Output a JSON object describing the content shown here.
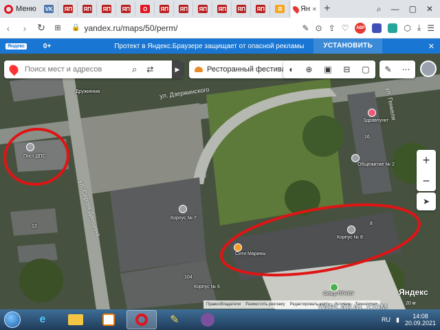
{
  "browser": {
    "menu_label": "Меню",
    "active_tab_label": "Ян",
    "url": "yandex.ru/maps/50/perm/",
    "adblock_count": "ABP",
    "mini_tabs": [
      {
        "icon": "vk-icon",
        "glyph": "VK",
        "color": "#4a76a8"
      },
      {
        "icon": "news-icon",
        "glyph": "ЯП",
        "color": "#b71c1c"
      },
      {
        "icon": "news-icon",
        "glyph": "ЯП",
        "color": "#b71c1c"
      },
      {
        "icon": "news-icon",
        "glyph": "ЯП",
        "color": "#b71c1c"
      },
      {
        "icon": "news-icon",
        "glyph": "ЯП",
        "color": "#b71c1c"
      },
      {
        "icon": "opera-icon",
        "glyph": "O",
        "color": "#e0141e"
      },
      {
        "icon": "news-icon",
        "glyph": "ЯП",
        "color": "#b71c1c"
      },
      {
        "icon": "news-icon",
        "glyph": "ЯП",
        "color": "#b71c1c"
      },
      {
        "icon": "news-icon",
        "glyph": "ЯП",
        "color": "#b71c1c"
      },
      {
        "icon": "news-icon",
        "glyph": "ЯП",
        "color": "#b71c1c"
      },
      {
        "icon": "news-icon",
        "glyph": "ЯП",
        "color": "#b71c1c"
      },
      {
        "icon": "news-icon",
        "glyph": "ЯП",
        "color": "#b71c1c"
      },
      {
        "icon": "yandex-icon",
        "glyph": "Я",
        "color": "#f5a623"
      }
    ]
  },
  "notification": {
    "badge": "Яндекс",
    "zero": "0+",
    "message": "Протект в Яндекс.Браузере защищает от опасной рекламы",
    "install": "УСТАНОВИТЬ",
    "close": "✕"
  },
  "map": {
    "search_placeholder": "Поиск мест и адресов",
    "festival_chip": "Ресторанный фестиваль",
    "logo": "Яндекс",
    "footer": [
      "Правообладатели",
      "Разместить рекламу",
      "Редактировать карту",
      "Условия",
      "Технологии"
    ],
    "scale": "20 м",
    "labels": {
      "street1": "ул. Дзержинского",
      "street2": "ул. Сергея Данщина",
      "street3": "ул. Генкеля",
      "dps": "Пост ДПС",
      "korpus7": "Корпус № 7",
      "korpus8": "Корпус № 8",
      "korpus6": "Корпус № 6",
      "marina": "Сити Марины",
      "zdravpunkt": "Здравпункт",
      "obshezhitie": "Общежитие № 2",
      "skver": "Сквер ПГНИУ",
      "druzhinnik": "Дружинник",
      "num12": "12",
      "num104": "104",
      "num8": "8",
      "num16": "16"
    }
  },
  "watermark": "YAPLAKAL.COM",
  "taskbar": {
    "lang": "RU",
    "time": "14:08",
    "date": "20.09.2021"
  }
}
